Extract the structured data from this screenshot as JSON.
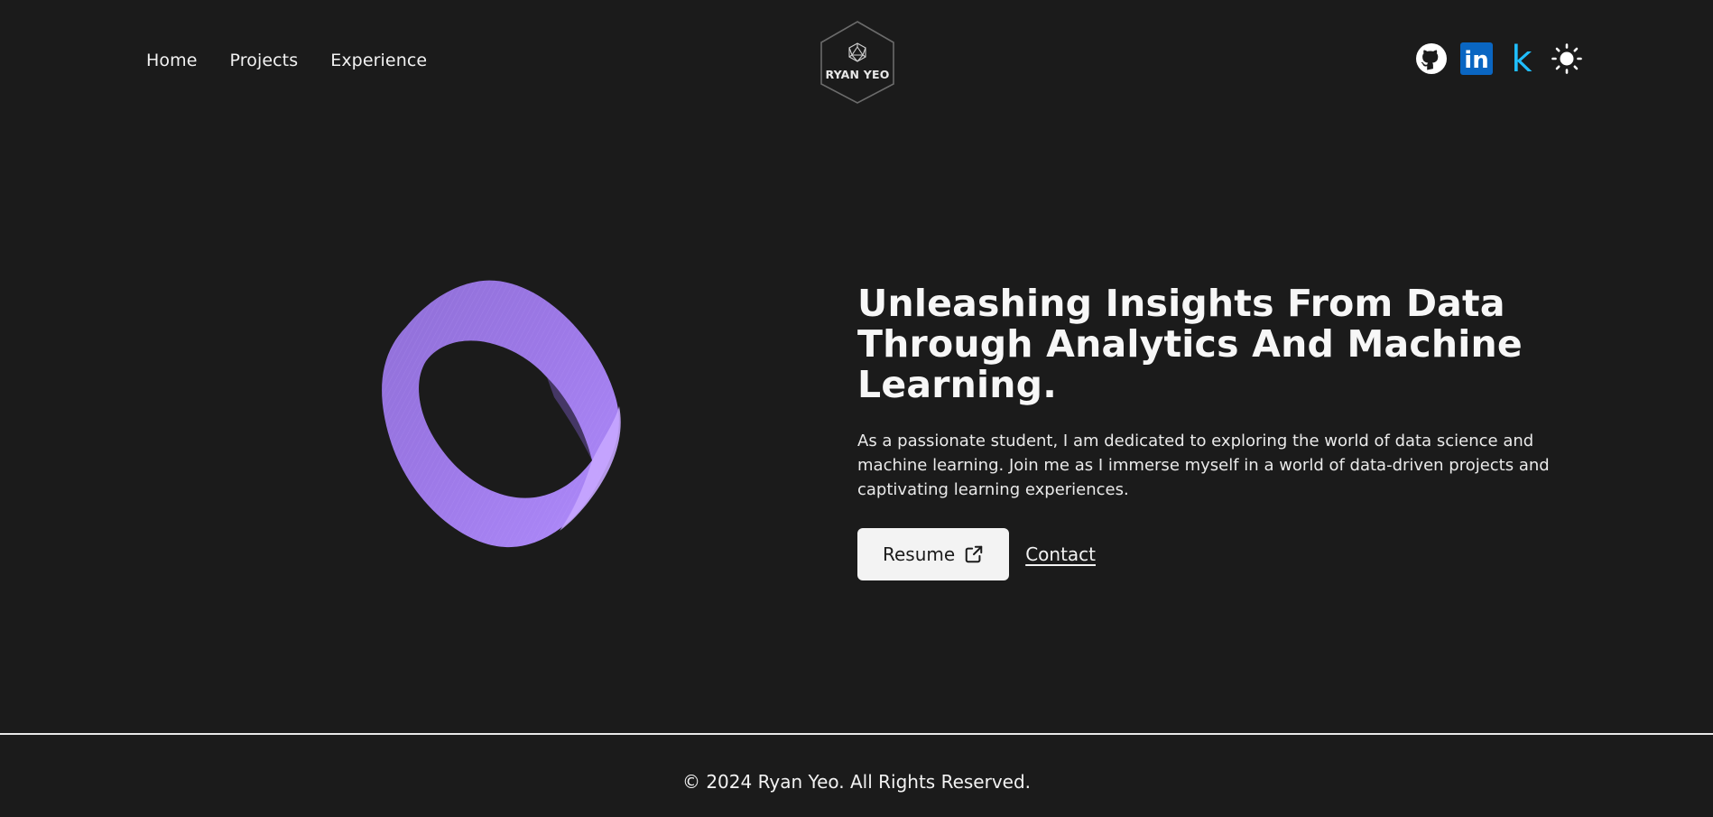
{
  "nav": {
    "items": [
      {
        "label": "Home"
      },
      {
        "label": "Projects"
      },
      {
        "label": "Experience"
      }
    ]
  },
  "logo": {
    "text": "RYAN YEO"
  },
  "social": {
    "icons": [
      "github-icon",
      "linkedin-icon",
      "kaggle-icon",
      "sun-icon"
    ],
    "linkedin_text": "in",
    "kaggle_text": "k",
    "colors": {
      "linkedin": "#0a66c2",
      "kaggle": "#20beff"
    }
  },
  "hero": {
    "title": "Unleashing Insights From Data Through Analytics And Machine Learning.",
    "description": "As a passionate student, I am dedicated to exploring the world of data science and machine learning. Join me as I immerse myself in a world of data-driven projects and captivating learning experiences.",
    "resume_label": "Resume",
    "contact_label": "Contact"
  },
  "footer": {
    "text": "© 2024 Ryan Yeo. All Rights Reserved."
  },
  "colors": {
    "background": "#1b1b1b",
    "text": "#f2f2f2",
    "mobius": "#a57ff0"
  }
}
